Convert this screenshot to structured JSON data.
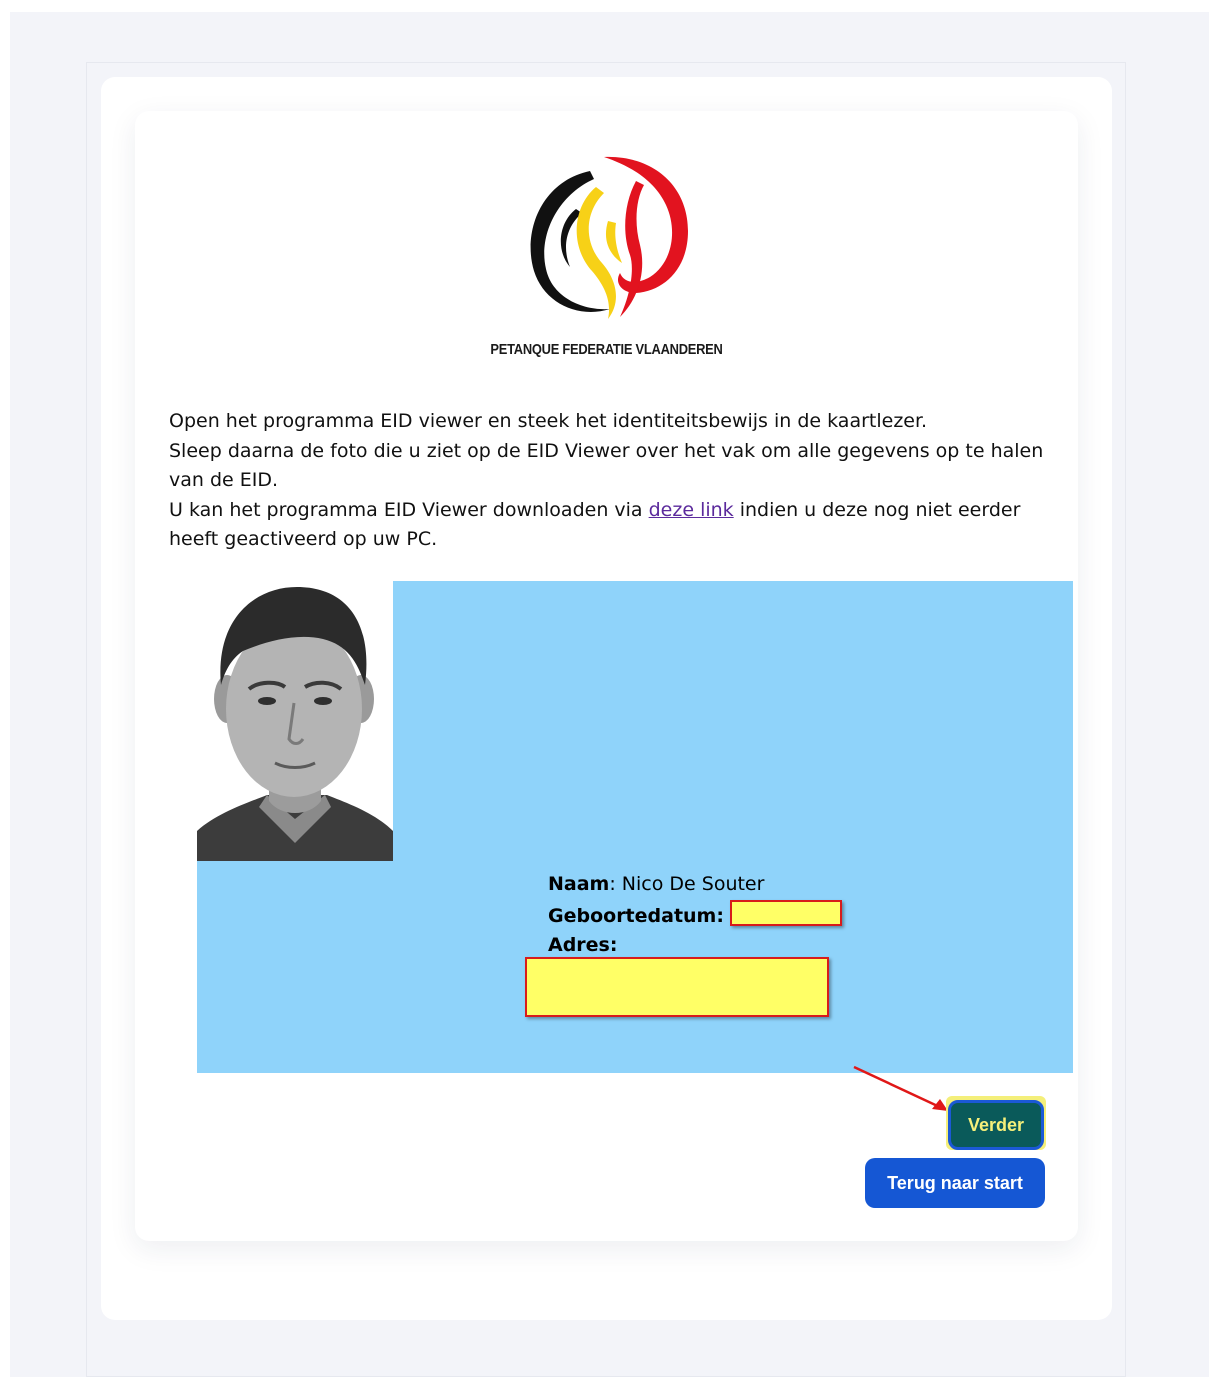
{
  "logo": {
    "org_name": "PETANQUE FEDERATIE VLAANDEREN",
    "colors": {
      "black": "#111111",
      "yellow": "#f7d117",
      "red": "#e2131f"
    }
  },
  "intro": {
    "line1": "Open het programma EID viewer en steek het identiteitsbewijs in de kaartlezer.",
    "line2": "Sleep daarna de foto die u ziet op de EID Viewer over het vak om alle gegevens op te halen van de EID.",
    "line3_before": "U kan het programma EID Viewer downloaden via ",
    "link_text": "deze link",
    "line3_after": " indien u deze nog niet eerder heeft geactiveerd op uw PC."
  },
  "eid": {
    "name_label": "Naam",
    "name_sep": ": ",
    "name_value": "Nico De Souter",
    "birthdate_label": "Geboortedatum:",
    "address_label": "Adres:",
    "dropzone_color": "#8fd3fa",
    "redaction_color": "#ffff66"
  },
  "buttons": {
    "next_label": "Verder",
    "back_label": "Terug naar start"
  }
}
